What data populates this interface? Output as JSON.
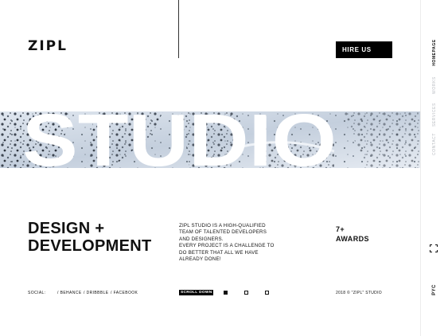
{
  "brand": {
    "logo": "ZIPL"
  },
  "header": {
    "hire_label": "HIRE US"
  },
  "nav": {
    "items": [
      {
        "label": "HOMEPAGE",
        "active": true
      },
      {
        "label": "WORKS",
        "active": false
      },
      {
        "label": "SERVICES",
        "active": false
      },
      {
        "label": "CONTACT",
        "active": false
      }
    ],
    "expand_icon": "fullscreen-icon",
    "lang": "PYC"
  },
  "hero": {
    "word": "STUDIO",
    "background": "snowy-forest-aerial-photo"
  },
  "intro": {
    "headline_line1": "DESIGN +",
    "headline_line2": "DEVELOPMENT",
    "description_lines": [
      "ZIPL STUDIO IS A HIGH-QUALIFIED",
      "TEAM OF TALENTED DEVELOPERS",
      "AND DESIGNERS.",
      "EVERY PROJECT IS A CHALLENGE TO",
      "DO BETTER THAT ALL WE HAVE",
      "ALREADY DONE!"
    ],
    "awards_count": "7+",
    "awards_label": "AWARDS"
  },
  "footer": {
    "social_label": "SOCIAL:",
    "social_links": [
      "/ BEHANCE",
      "/ DRIBBBLE",
      "/ FACEBOOK"
    ],
    "scroll_label": "SCROLL DOWN",
    "pager_active": 1,
    "pager_total": 3,
    "copyright": "2018 © \"ZIPL\" STUDIO"
  },
  "colors": {
    "accent": "#000000",
    "nav_dim": "#b9bcc2",
    "snow": "#c9d3e0"
  }
}
